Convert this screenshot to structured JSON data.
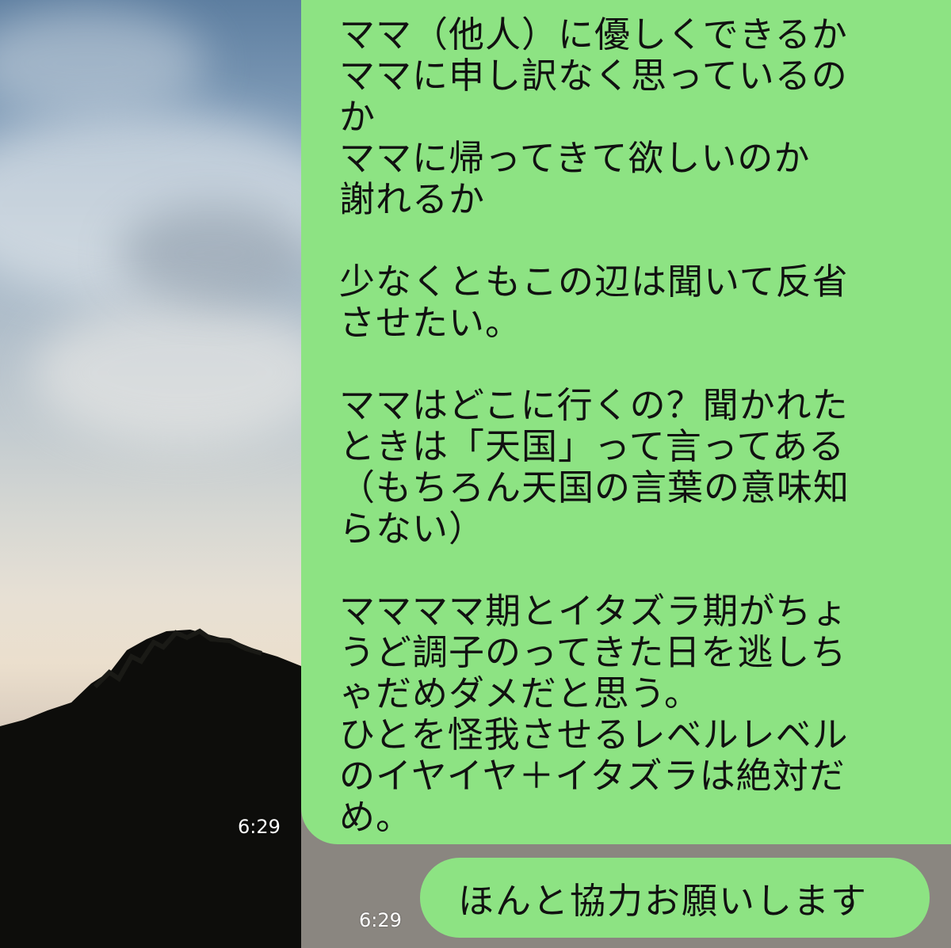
{
  "chat": {
    "messages": [
      {
        "lines": [
          "ママ（他人）に優しくできるか",
          "ママに申し訳なく思っているの",
          "か",
          "ママに帰ってきて欲しいのか",
          "謝れるか",
          "",
          "少なくともこの辺は聞いて反省",
          "させたい。",
          "",
          "ママはどこに行くの？聞かれた",
          "ときは「天国」って言ってある",
          "（もちろん天国の言葉の意味知",
          "らない）",
          "",
          "ママママ期とイタズラ期がちょ",
          "うど調子のってきた日を逃しち",
          "ゃだめダメだと思う。",
          "ひとを怪我させるレベルレベル",
          "のイヤイヤ＋イタズラは絶対だ",
          "め。"
        ],
        "time": "6:29"
      },
      {
        "text": "ほんと協力お願いします",
        "time": "6:29"
      }
    ]
  },
  "colors": {
    "bubble": "#8de383",
    "text": "#111111",
    "timestamp": "#ffffff"
  }
}
